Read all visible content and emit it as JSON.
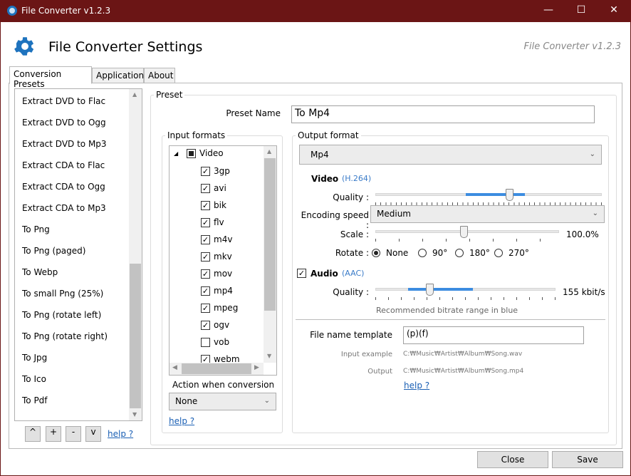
{
  "window": {
    "title": "File Converter v1.2.3",
    "minimize": "—",
    "maximize": "☐",
    "close": "✕"
  },
  "header": {
    "title": "File Converter Settings",
    "version": "File Converter v1.2.3"
  },
  "tabs": [
    {
      "label": "Conversion Presets",
      "selected": true
    },
    {
      "label": "Application"
    },
    {
      "label": "About"
    }
  ],
  "presets": [
    "Extract DVD to Flac",
    "Extract DVD to Ogg",
    "Extract DVD to Mp3",
    "Extract CDA to Flac",
    "Extract CDA to Ogg",
    "Extract CDA to Mp3",
    "To Png",
    "To Png (paged)",
    "To Webp",
    "To small Png (25%)",
    "To Png (rotate left)",
    "To Png (rotate right)",
    "To Jpg",
    "To Ico",
    "To Pdf"
  ],
  "list_buttons": {
    "up": "^",
    "add": "+",
    "remove": "-",
    "down": "v",
    "help": "help ?"
  },
  "preset": {
    "group": "Preset",
    "name_label": "Preset Name",
    "name_value": "To Mp4"
  },
  "input_formats": {
    "group": "Input formats",
    "root": "Video",
    "items": [
      {
        "label": "3gp",
        "checked": true
      },
      {
        "label": "avi",
        "checked": true
      },
      {
        "label": "bik",
        "checked": true
      },
      {
        "label": "flv",
        "checked": true
      },
      {
        "label": "m4v",
        "checked": true
      },
      {
        "label": "mkv",
        "checked": true
      },
      {
        "label": "mov",
        "checked": true
      },
      {
        "label": "mp4",
        "checked": true
      },
      {
        "label": "mpeg",
        "checked": true
      },
      {
        "label": "ogv",
        "checked": true
      },
      {
        "label": "vob",
        "checked": false
      },
      {
        "label": "webm",
        "checked": true
      }
    ],
    "action_label": "Action when conversion s",
    "action_value": "None",
    "help": "help ?"
  },
  "output": {
    "group": "Output format",
    "format": "Mp4",
    "video": {
      "label": "Video",
      "codec": "(H.264)",
      "quality_label": "Quality :",
      "quality": 0.59,
      "rec_range": [
        0.4,
        0.66
      ],
      "speed_label": "Encoding speed :",
      "speed": "Medium",
      "scale_label": "Scale :",
      "scale": "100.0%",
      "rotate_label": "Rotate :",
      "rotate_options": [
        "None",
        "90°",
        "180°",
        "270°"
      ],
      "rotate_selected": "None"
    },
    "audio": {
      "enabled": true,
      "label": "Audio",
      "codec": "(AAC)",
      "quality_label": "Quality :",
      "bitrate": "155 kbit/s",
      "quality": 0.3,
      "rec_range": [
        0.18,
        0.54
      ],
      "hint": "Recommended bitrate range in blue"
    },
    "template_label": "File name template",
    "template_value": "(p)(f)",
    "input_example_label": "Input example",
    "input_example": "C:₩Music₩Artist₩Album₩Song.wav",
    "output_label": "Output",
    "output_example": "C:₩Music₩Artist₩Album₩Song.mp4",
    "help": "help ?"
  },
  "footer": {
    "close": "Close",
    "save": "Save"
  },
  "colors": {
    "titlebar": "#6b1515",
    "accent": "#1e73be",
    "range": "#3c8ce0"
  }
}
